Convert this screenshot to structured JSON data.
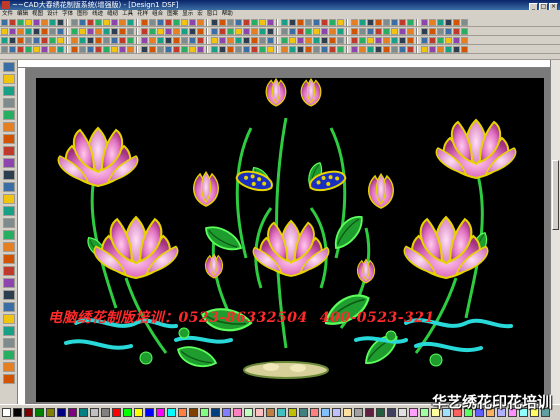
{
  "window": {
    "title": "~~CAD大春绣花制版系统(增强版) - [Design1 DSF]"
  },
  "menu": {
    "items": [
      "文件",
      "编辑",
      "视图",
      "设计",
      "字体",
      "图形",
      "线迹",
      "缝纫",
      "工具",
      "花样",
      "组合",
      "图案",
      "显示",
      "宏",
      "窗口",
      "帮助"
    ]
  },
  "canvas": {
    "background": "#000000",
    "design": {
      "description_colors": {
        "petal_pink": "#e88fd0",
        "petal_outline": "#e0d000",
        "leaf_green": "#2ecc40",
        "water_cyan": "#29d8d8",
        "seedpod_blue": "#1a2fc0"
      }
    }
  },
  "promo": {
    "part1": "电脑绣花制版培训：",
    "phone1": "0523-86332504",
    "phone2": "400-0523-321"
  },
  "watermark": {
    "text": "华艺绣花印花培训"
  },
  "palette": {
    "colors": [
      "#ffffff",
      "#000000",
      "#800000",
      "#008000",
      "#808000",
      "#000080",
      "#800080",
      "#008080",
      "#c0c0c0",
      "#808080",
      "#ff0000",
      "#00ff00",
      "#ffff00",
      "#0000ff",
      "#ff00ff",
      "#00ffff",
      "#ff8040",
      "#804000",
      "#80ff80",
      "#004080",
      "#8080ff",
      "#ff80c0",
      "#c0ffc0",
      "#ffc0c0",
      "#c08040",
      "#40c0c0",
      "#c0c000",
      "#408080",
      "#ff8080",
      "#80c0ff",
      "#c0c0ff",
      "#ffe0a0",
      "#a0a0a0",
      "#602040",
      "#206040",
      "#404060",
      "#e0e0e0",
      "#ffa0ff",
      "#a0ffa0",
      "#ffffa0",
      "#a0e0ff",
      "#ff6060",
      "#60ff60",
      "#6060ff",
      "#ffb060",
      "#b0b0ff",
      "#ff90ff",
      "#90ffff",
      "#ffff60",
      "#60a0a0"
    ]
  }
}
